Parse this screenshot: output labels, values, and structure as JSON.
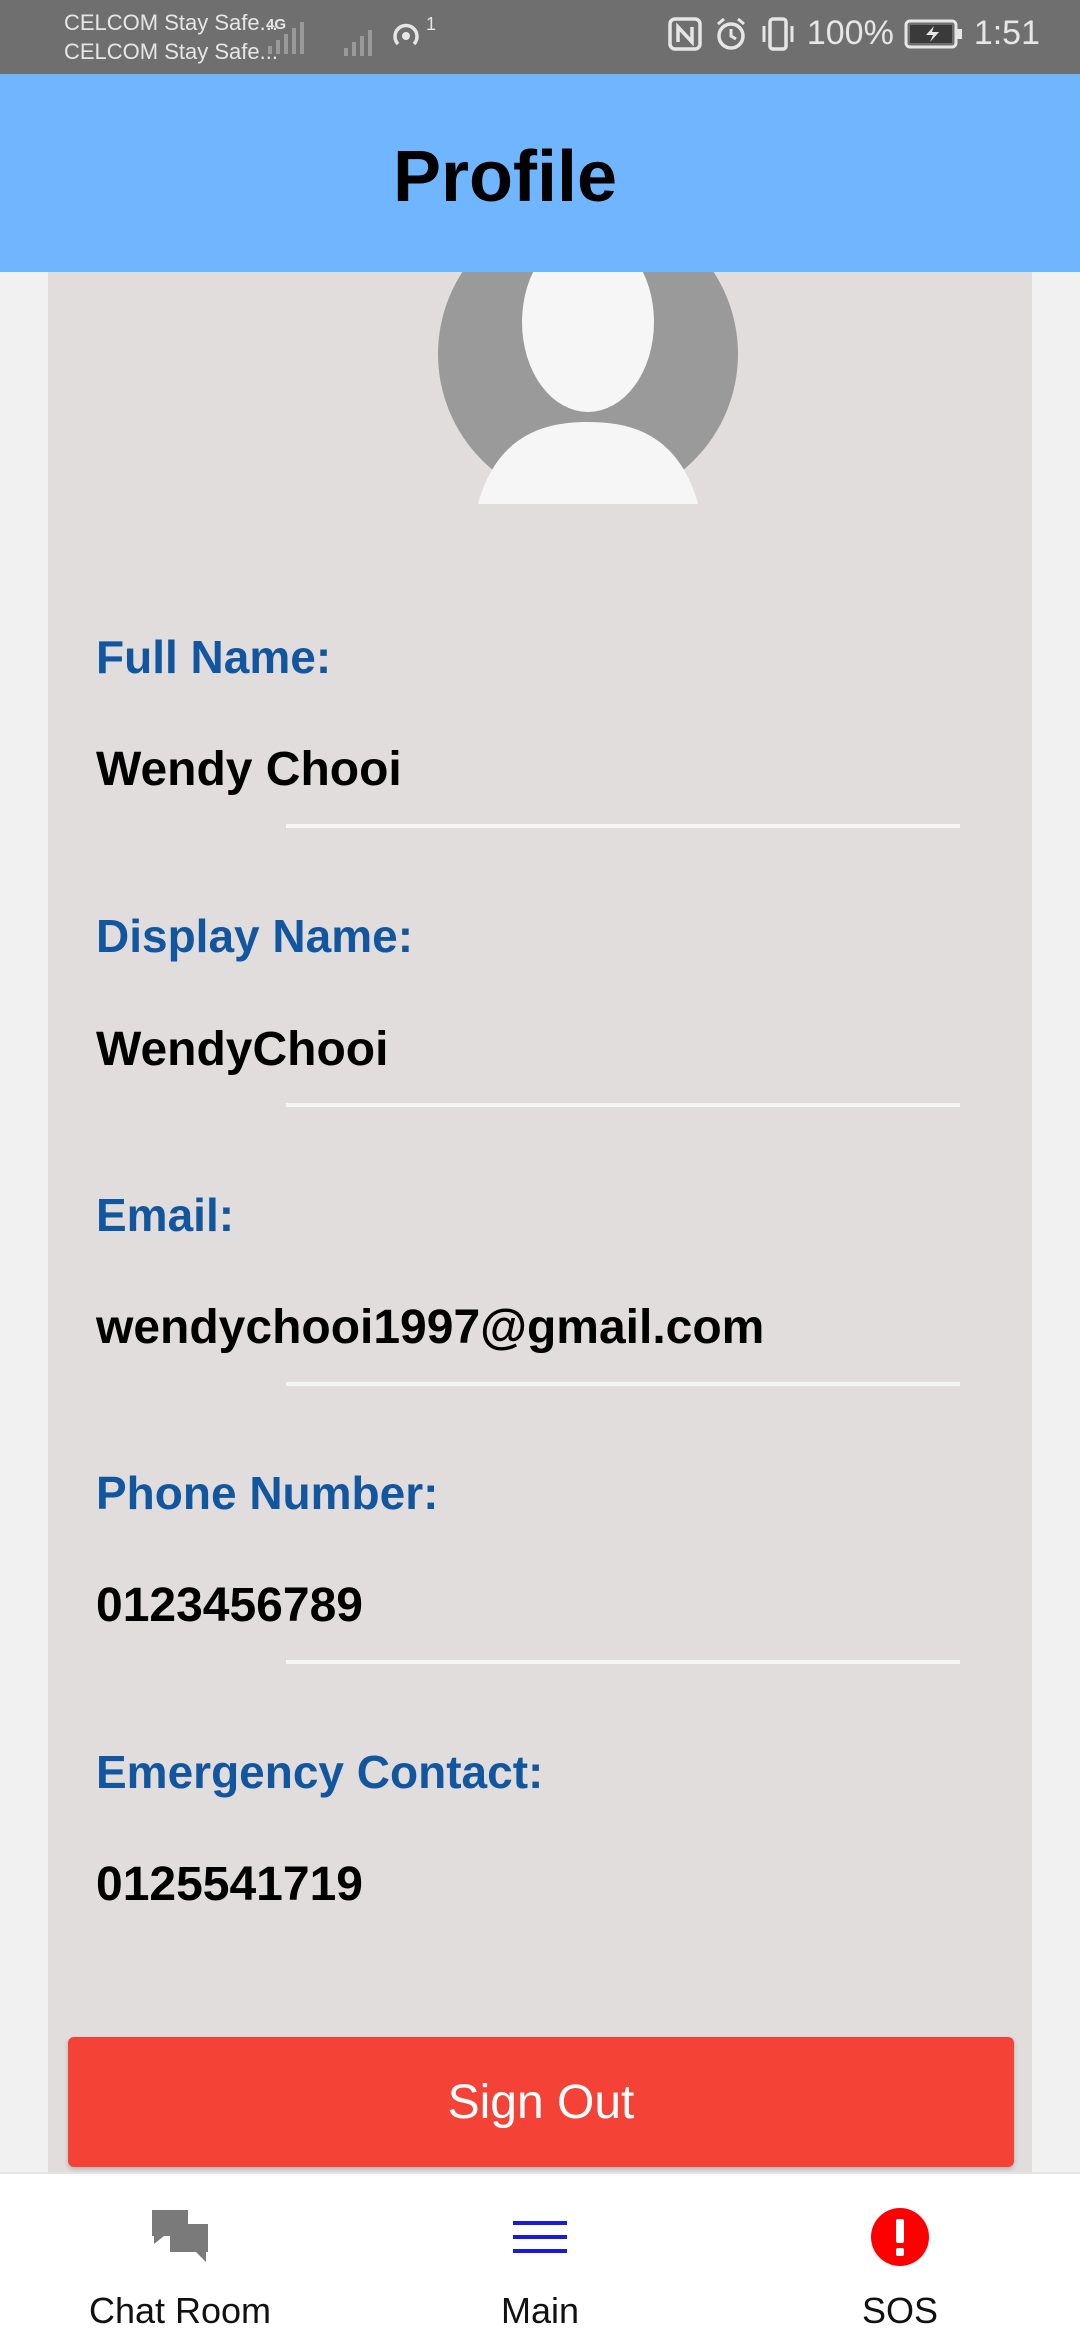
{
  "status_bar": {
    "carrier_1": "CELCOM Stay Safe...",
    "carrier_2": "CELCOM Stay Safe...",
    "network": "4G",
    "battery": "100%",
    "time": "1:51",
    "hotspot_count": "1"
  },
  "header": {
    "title": "Profile"
  },
  "profile": {
    "fields": [
      {
        "label": "Full Name:",
        "value": "Wendy Chooi"
      },
      {
        "label": "Display Name:",
        "value": "WendyChooi"
      },
      {
        "label": "Email:",
        "value": "wendychooi1997@gmail.com"
      },
      {
        "label": "Phone Number:",
        "value": "0123456789"
      },
      {
        "label": "Emergency Contact:",
        "value": "0125541719"
      }
    ]
  },
  "actions": {
    "sign_out": "Sign Out"
  },
  "bottom_nav": {
    "items": [
      {
        "label": "Chat Room",
        "icon": "chat-icon"
      },
      {
        "label": "Main",
        "icon": "menu-icon"
      },
      {
        "label": "SOS",
        "icon": "alert-icon"
      }
    ]
  },
  "colors": {
    "app_bar": "#6fb6fe",
    "label": "#1356a0",
    "sign_out": "#f44336",
    "sos": "#ff0000",
    "main_icon": "#1a1adf"
  }
}
